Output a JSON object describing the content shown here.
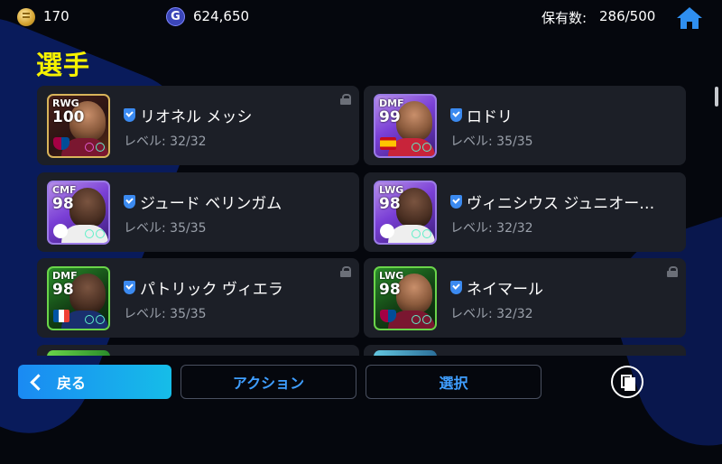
{
  "header": {
    "coins": "170",
    "gp_icon_letter": "G",
    "gp": "624,650",
    "owned_label": "保有数:",
    "owned_value": "286/500"
  },
  "page_title": "選手",
  "players": [
    {
      "position": "RWG",
      "rating": "100",
      "name": "リオネル メッシ",
      "level": "レベル: 32/32",
      "locked": true
    },
    {
      "position": "DMF",
      "rating": "99",
      "name": "ロドリ",
      "level": "レベル: 35/35",
      "locked": false
    },
    {
      "position": "CMF",
      "rating": "98",
      "name": "ジュード ベリンガム",
      "level": "レベル: 35/35",
      "locked": false
    },
    {
      "position": "LWG",
      "rating": "98",
      "name": "ヴィニシウス ジュニオー…",
      "level": "レベル: 32/32",
      "locked": false
    },
    {
      "position": "DMF",
      "rating": "98",
      "name": "パトリック ヴィエラ",
      "level": "レベル: 35/35",
      "locked": true
    },
    {
      "position": "LWG",
      "rating": "98",
      "name": "ネイマール",
      "level": "レベル: 32/32",
      "locked": true
    }
  ],
  "footer": {
    "back_label": "戻る",
    "action_label": "アクション",
    "select_label": "選択"
  },
  "colors": {
    "title": "#f6f200",
    "accent": "#3f9eff",
    "card_bg": "#1c1f27",
    "verified": "#3b8af0"
  }
}
